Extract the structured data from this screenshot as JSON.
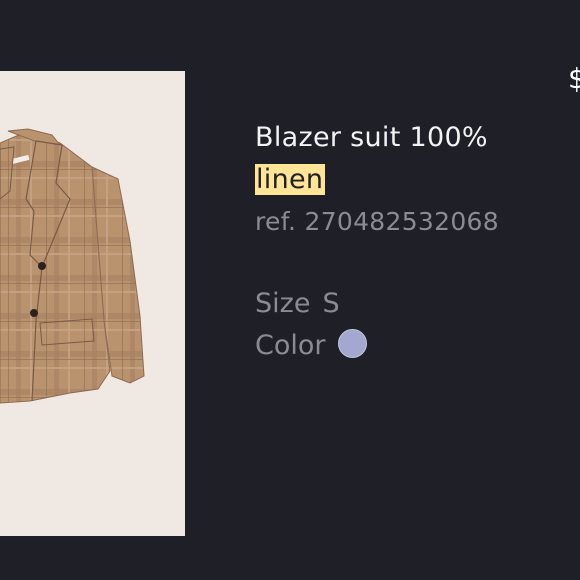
{
  "product": {
    "price_partial": "$",
    "title_line1": "Blazer suit 100%",
    "title_line2": "linen",
    "ref": "ref. 270482532068",
    "size_label": "Size",
    "size_value": "S",
    "color_label": "Color",
    "color_swatch": "#a4a8d0",
    "image_icon": "plaid-blazer-product-image"
  }
}
